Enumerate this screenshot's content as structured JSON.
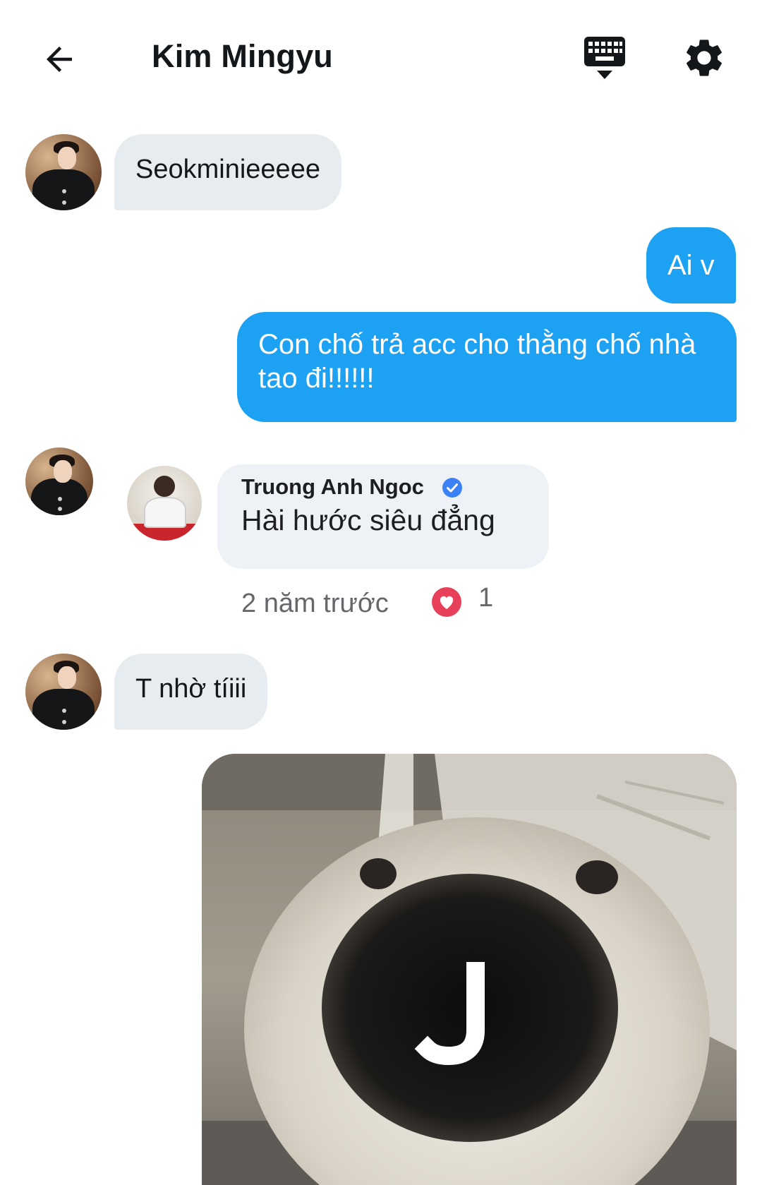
{
  "header": {
    "back_icon": "arrow-left-icon",
    "title": "Kim Mingyu",
    "keyboard_icon": "keyboard-hide-icon",
    "settings_icon": "gear-icon"
  },
  "messages": [
    {
      "direction": "in",
      "text": "Seokminieeeee"
    },
    {
      "direction": "out",
      "text": "Ai v"
    },
    {
      "direction": "out",
      "text": "Con chố trả acc cho thằng chố nhà tao đi!!!!!!"
    },
    {
      "direction": "in",
      "type": "image",
      "embedded_comment": {
        "author": "Truong Anh Ngoc",
        "verified_icon": "verified-badge-icon",
        "text": "Hài hước siêu đẳng",
        "time": "2 năm trước",
        "reaction_icon": "heart-reaction-icon",
        "reaction_count": "1"
      }
    },
    {
      "direction": "in",
      "text": "T nhờ tíiii"
    },
    {
      "direction": "out",
      "type": "image",
      "image_caption_letter": "J"
    }
  ],
  "colors": {
    "accent": "#1da1f2",
    "incoming_bubble": "#e6ecf0",
    "text": "#14171a"
  }
}
